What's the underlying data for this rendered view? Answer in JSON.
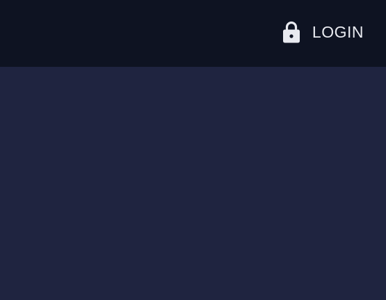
{
  "header": {
    "login": {
      "label": "LOGIN",
      "icon": "lock-icon"
    }
  },
  "colors": {
    "header_bg": "#0e1322",
    "page_bg": "#1f2440",
    "text": "#e8eaf0"
  }
}
